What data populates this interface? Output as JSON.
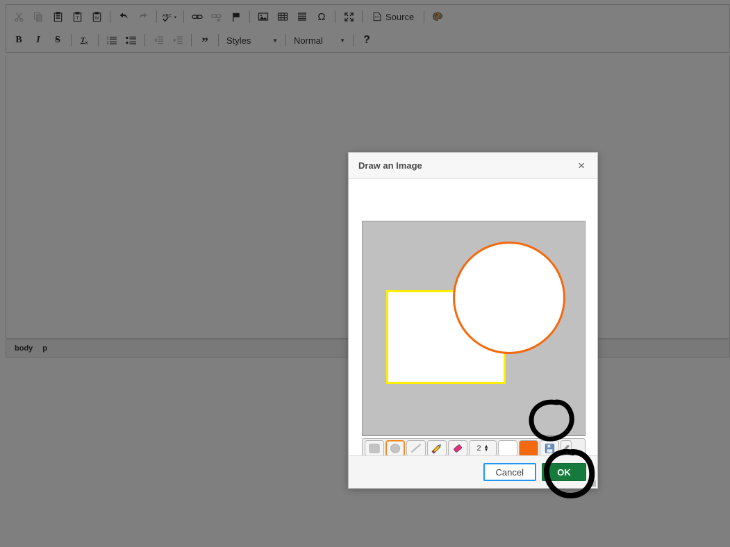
{
  "editor": {
    "toolbar_row1": [
      {
        "name": "cut",
        "label": "Cut",
        "icon": "scissors-icon",
        "disabled": true
      },
      {
        "name": "copy",
        "label": "Copy",
        "icon": "copy-icon",
        "disabled": true
      },
      {
        "name": "paste",
        "label": "Paste",
        "icon": "paste-icon",
        "disabled": false
      },
      {
        "name": "paste-as-plain-text",
        "label": "Paste as plain text",
        "icon": "paste-text-icon",
        "disabled": false
      },
      {
        "name": "paste-from-word",
        "label": "Paste from Word",
        "icon": "paste-word-icon",
        "disabled": false
      },
      {
        "name": "separator",
        "label": "",
        "icon": "separator",
        "disabled": false
      },
      {
        "name": "undo",
        "label": "Undo",
        "icon": "undo-arrow-icon",
        "disabled": false
      },
      {
        "name": "redo",
        "label": "Redo",
        "icon": "redo-arrow-icon",
        "disabled": true
      },
      {
        "name": "separator",
        "label": "",
        "icon": "separator",
        "disabled": false
      },
      {
        "name": "spell-check",
        "label": "Spell Check As You Type",
        "icon": "abc-check-icon",
        "disabled": false
      },
      {
        "name": "separator",
        "label": "",
        "icon": "separator",
        "disabled": false
      },
      {
        "name": "link",
        "label": "Link",
        "icon": "chain-link-icon",
        "disabled": false
      },
      {
        "name": "unlink",
        "label": "Unlink",
        "icon": "broken-link-icon",
        "disabled": true
      },
      {
        "name": "anchor",
        "label": "Anchor",
        "icon": "flag-icon",
        "disabled": false
      },
      {
        "name": "separator",
        "label": "",
        "icon": "separator",
        "disabled": false
      },
      {
        "name": "image",
        "label": "Image",
        "icon": "picture-icon",
        "disabled": false
      },
      {
        "name": "table",
        "label": "Table",
        "icon": "table-grid-icon",
        "disabled": false
      },
      {
        "name": "horizontal-rule",
        "label": "Horizontal Line",
        "icon": "horizontal-lines-icon",
        "disabled": false
      },
      {
        "name": "special-char",
        "label": "Insert Special Character",
        "icon": "omega-icon",
        "disabled": false
      },
      {
        "name": "separator",
        "label": "",
        "icon": "separator",
        "disabled": false
      },
      {
        "name": "maximize",
        "label": "Maximize",
        "icon": "maximize-arrows-icon",
        "disabled": false
      },
      {
        "name": "separator",
        "label": "",
        "icon": "separator",
        "disabled": false
      }
    ],
    "source_label": "Source",
    "toolbar_row2": [
      {
        "name": "bold",
        "label": "B",
        "icon": "bold-icon",
        "disabled": false
      },
      {
        "name": "italic",
        "label": "I",
        "icon": "italic-icon",
        "disabled": false
      },
      {
        "name": "strike",
        "label": "S",
        "icon": "strikethrough-icon",
        "disabled": false
      },
      {
        "name": "separator",
        "label": "",
        "icon": "separator",
        "disabled": false
      },
      {
        "name": "remove-format",
        "label": "Tx",
        "icon": "remove-format-icon",
        "disabled": false
      },
      {
        "name": "separator",
        "label": "",
        "icon": "separator",
        "disabled": false
      },
      {
        "name": "numbered-list",
        "label": "",
        "icon": "numbered-list-icon",
        "disabled": false
      },
      {
        "name": "bulleted-list",
        "label": "",
        "icon": "bulleted-list-icon",
        "disabled": false
      },
      {
        "name": "separator",
        "label": "",
        "icon": "separator",
        "disabled": false
      },
      {
        "name": "outdent",
        "label": "",
        "icon": "outdent-icon",
        "disabled": true
      },
      {
        "name": "indent",
        "label": "",
        "icon": "indent-icon",
        "disabled": true
      },
      {
        "name": "separator",
        "label": "",
        "icon": "separator",
        "disabled": false
      },
      {
        "name": "blockquote",
        "label": "",
        "icon": "quote-icon",
        "disabled": false
      },
      {
        "name": "separator",
        "label": "",
        "icon": "separator",
        "disabled": false
      }
    ],
    "styles_combo": "Styles",
    "format_combo": "Normal",
    "help_label": "?",
    "status_bar": {
      "element_path": [
        "body",
        "p"
      ]
    }
  },
  "dialog": {
    "title": "Draw an Image",
    "close_label": "×",
    "canvas": {
      "background_color": "#c0c0c0",
      "shapes": [
        {
          "name": "rectangle",
          "type": "rect",
          "stroke": "#ffee00",
          "fill": "#ffffff"
        },
        {
          "name": "circle",
          "type": "circle",
          "stroke": "#f4690d",
          "fill": "#ffffff"
        }
      ]
    },
    "paint_tools": [
      {
        "name": "rectangle-tool",
        "icon": "rectangle-icon",
        "selected": false
      },
      {
        "name": "ellipse-tool",
        "icon": "ellipse-icon",
        "selected": true
      },
      {
        "name": "line-tool",
        "icon": "line-icon",
        "selected": false
      },
      {
        "name": "pencil-tool",
        "icon": "pencil-icon",
        "selected": false
      },
      {
        "name": "eraser-tool",
        "icon": "eraser-icon",
        "selected": false
      }
    ],
    "stroke_size": "2",
    "fill_color": "#ffffff",
    "stroke_color": "#f4690d",
    "save_tool": {
      "name": "save-tool",
      "icon": "floppy-disk-icon"
    },
    "brush_tool": {
      "name": "brush-tool",
      "icon": "paint-brush-icon"
    },
    "buttons": {
      "cancel": "Cancel",
      "ok": "OK"
    }
  }
}
